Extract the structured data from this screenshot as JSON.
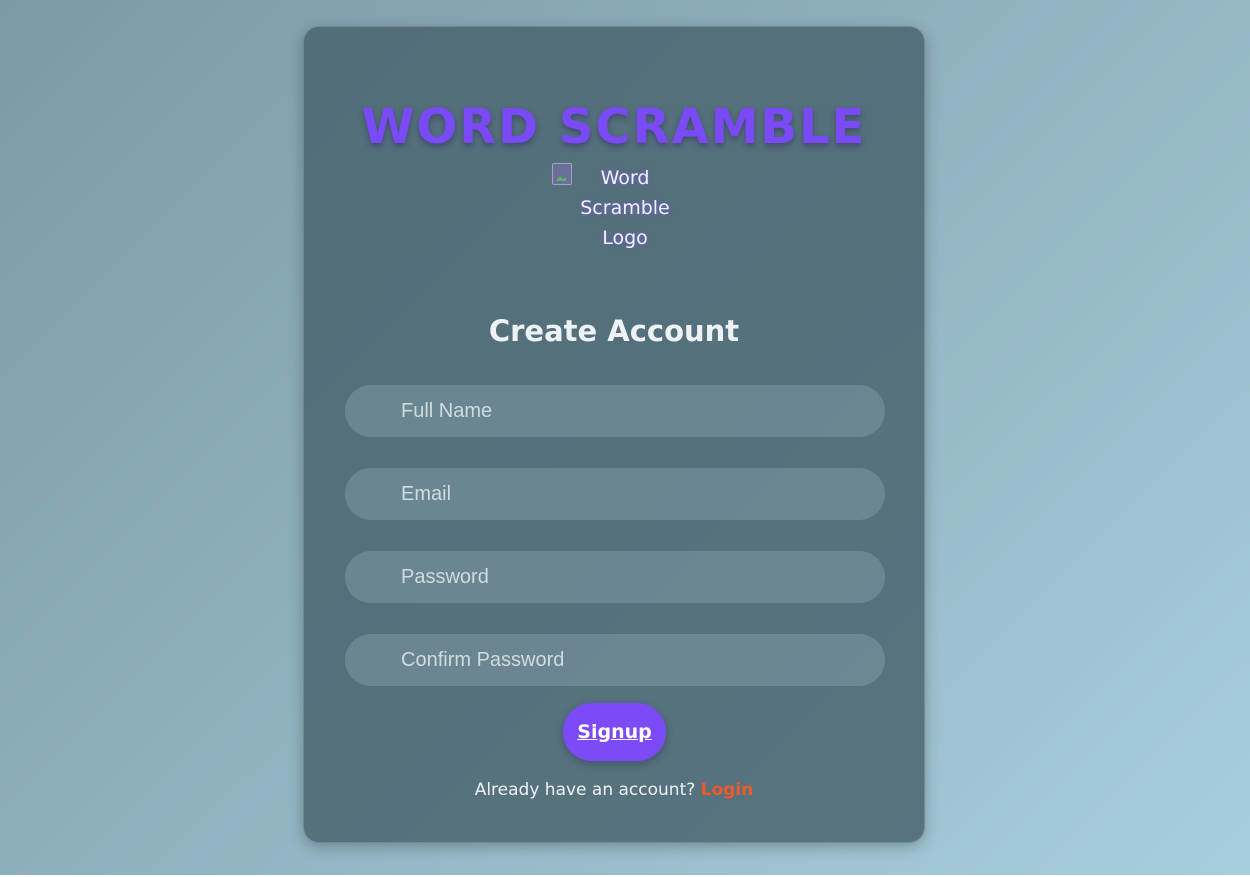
{
  "app": {
    "title": "WORD SCRAMBLE",
    "logo_alt": "Word Scramble Logo"
  },
  "form": {
    "heading": "Create Account",
    "fields": [
      {
        "placeholder": "Full Name",
        "value": ""
      },
      {
        "placeholder": "Email",
        "value": ""
      },
      {
        "placeholder": "Password",
        "value": ""
      },
      {
        "placeholder": "Confirm Password",
        "value": ""
      }
    ],
    "submit_label": "Signup"
  },
  "footer": {
    "prompt": "Already have an account?",
    "login_label": "Login"
  },
  "colors": {
    "accent": "#7c4af6",
    "link": "#f05a28"
  }
}
